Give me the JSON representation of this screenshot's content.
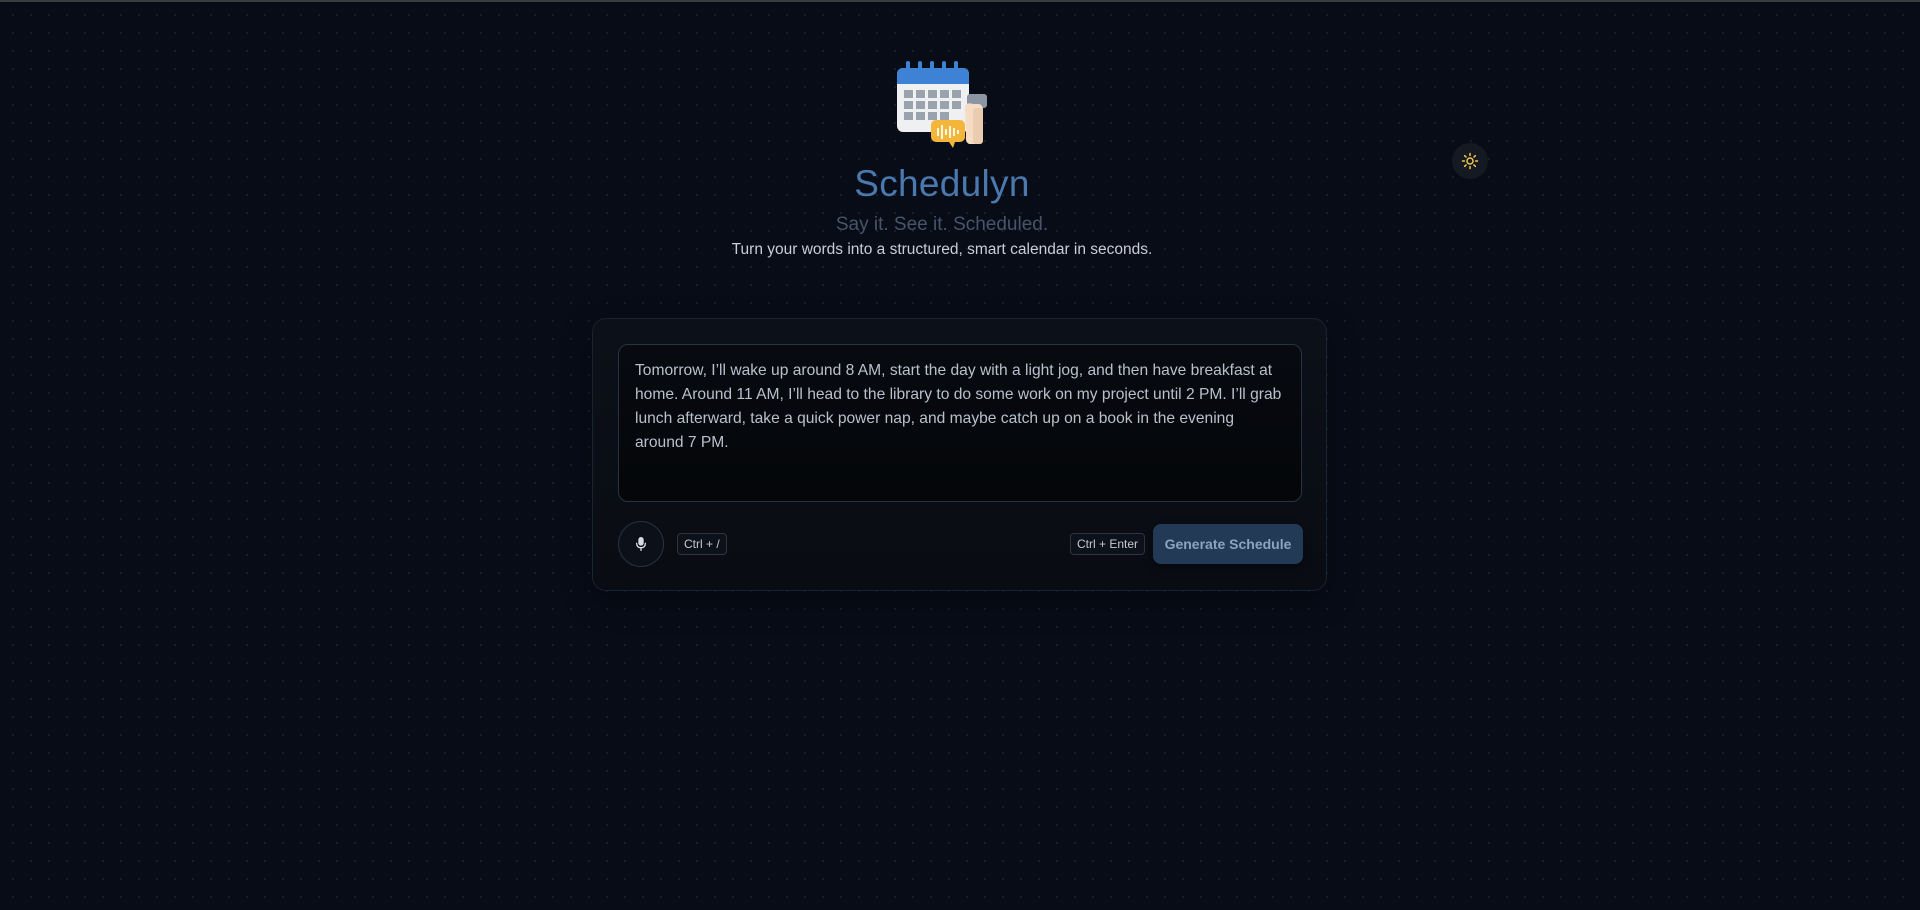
{
  "header": {
    "title": "Schedulyn",
    "tagline": "Say it. See it. Scheduled.",
    "description": "Turn your words into a structured, smart calendar in seconds.",
    "logo_icon": "calendar-with-voice-bubble-icon"
  },
  "theme_toggle": {
    "icon": "sun-icon",
    "color": "#f2c94c"
  },
  "composer": {
    "input_value": "Tomorrow, I’ll wake up around 8 AM, start the day with a light jog, and then have breakfast at home. Around 11 AM, I’ll head to the library to do some work on my project until 2 PM. I’ll grab lunch afterward, take a quick power nap, and maybe catch up on a book in the evening around 7 PM.",
    "mic_icon": "microphone-icon",
    "mic_shortcut": "Ctrl + /",
    "generate_shortcut": "Ctrl + Enter",
    "generate_label": "Generate Schedule"
  },
  "colors": {
    "background": "#070c17",
    "title": "#4b78ad",
    "accent_button": "#223a55"
  }
}
